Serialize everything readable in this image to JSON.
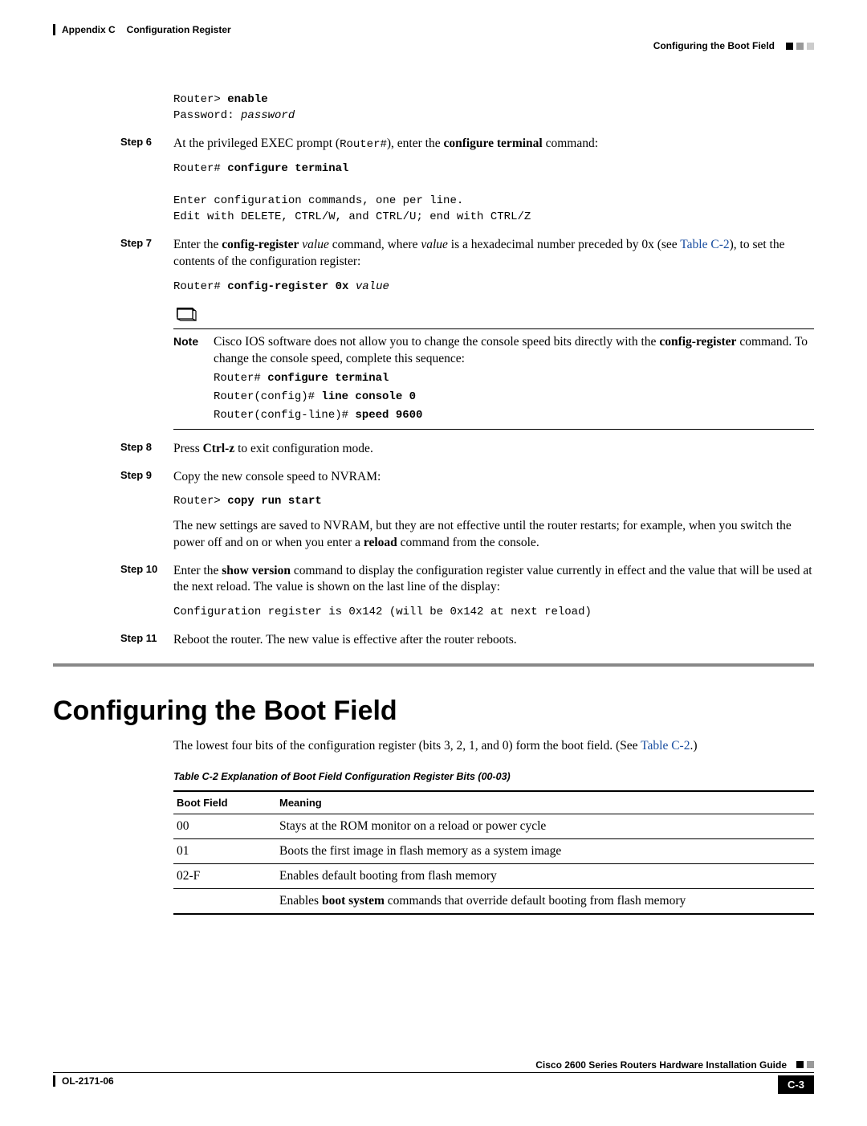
{
  "header": {
    "appendix": "Appendix C",
    "chapter": "Configuration Register",
    "section": "Configuring the Boot Field"
  },
  "pre1": {
    "l1a": "Router> ",
    "l1b": "enable",
    "l2a": "Password: ",
    "l2b": "password"
  },
  "step6": {
    "label": "Step 6",
    "t1": "At the privileged EXEC prompt (",
    "t1m": "Router#",
    "t2": "), enter the ",
    "t2b": "configure terminal",
    "t3": " command:",
    "code_a": "Router# ",
    "code_b": "configure terminal",
    "code_c": "Enter configuration commands, one per line.",
    "code_d": "Edit with DELETE, CTRL/W, and CTRL/U; end with CTRL/Z"
  },
  "step7": {
    "label": "Step 7",
    "t1": "Enter the ",
    "b1": "config-register",
    "i1": " value",
    "t2": " command, where ",
    "i2": "value",
    "t3": " is a hexadecimal number preceded by 0x (see ",
    "link": "Table C-2",
    "t4": "), to set the contents of the configuration register:",
    "code_a": "Router# ",
    "code_b": "config-register 0x ",
    "code_c": "value"
  },
  "note": {
    "label": "Note",
    "t1": "Cisco IOS software does not allow you to change the console speed bits directly with the ",
    "b1": "config-register",
    "t2": " command. To change the console speed, complete this sequence:",
    "c1a": "Router# ",
    "c1b": "configure terminal",
    "c2a": "Router(config)# ",
    "c2b": "line console 0",
    "c3a": "Router(config-line)# ",
    "c3b": "speed 9600"
  },
  "step8": {
    "label": "Step 8",
    "t1": "Press ",
    "b1": "Ctrl-z",
    "t2": " to exit configuration mode."
  },
  "step9": {
    "label": "Step 9",
    "t1": "Copy the new console speed to NVRAM:",
    "code_a": "Router> ",
    "code_b": "copy run start",
    "p1": "The new settings are saved to NVRAM, but they are not effective until the router restarts; for example, when you switch the power off and on or when you enter a ",
    "p1b": "reload",
    "p2": " command from the console."
  },
  "step10": {
    "label": "Step 10",
    "t1": "Enter the ",
    "b1": "show version",
    "t2": " command to display the configuration register value currently in effect and the value that will be used at the next reload. The value is shown on the last line of the display:",
    "code": "Configuration register is 0x142 (will be 0x142 at next reload)"
  },
  "step11": {
    "label": "Step 11",
    "t1": "Reboot the router. The new value is effective after the router reboots."
  },
  "h1": "Configuring the Boot Field",
  "intro": {
    "t1": "The lowest four bits of the configuration register (bits 3, 2, 1, and 0) form the boot field. (See ",
    "link": "Table C-2",
    "t2": ".)"
  },
  "table": {
    "caption": "Table C-2    Explanation of Boot Field Configuration Register Bits (00-03)",
    "h1": "Boot Field",
    "h2": "Meaning",
    "r0c0": "00",
    "r0c1": "Stays at the ROM monitor on a reload or power cycle",
    "r1c0": "01",
    "r1c1": "Boots the first image in flash memory as a system image",
    "r2c0": "02-F",
    "r2c1": "Enables default booting from flash memory",
    "r3c1a": "Enables ",
    "r3c1b": "boot system",
    "r3c1c": " commands that override default booting from flash memory"
  },
  "footer": {
    "guide": "Cisco 2600 Series Routers Hardware Installation Guide",
    "doc": "OL-2171-06",
    "page": "C-3"
  }
}
